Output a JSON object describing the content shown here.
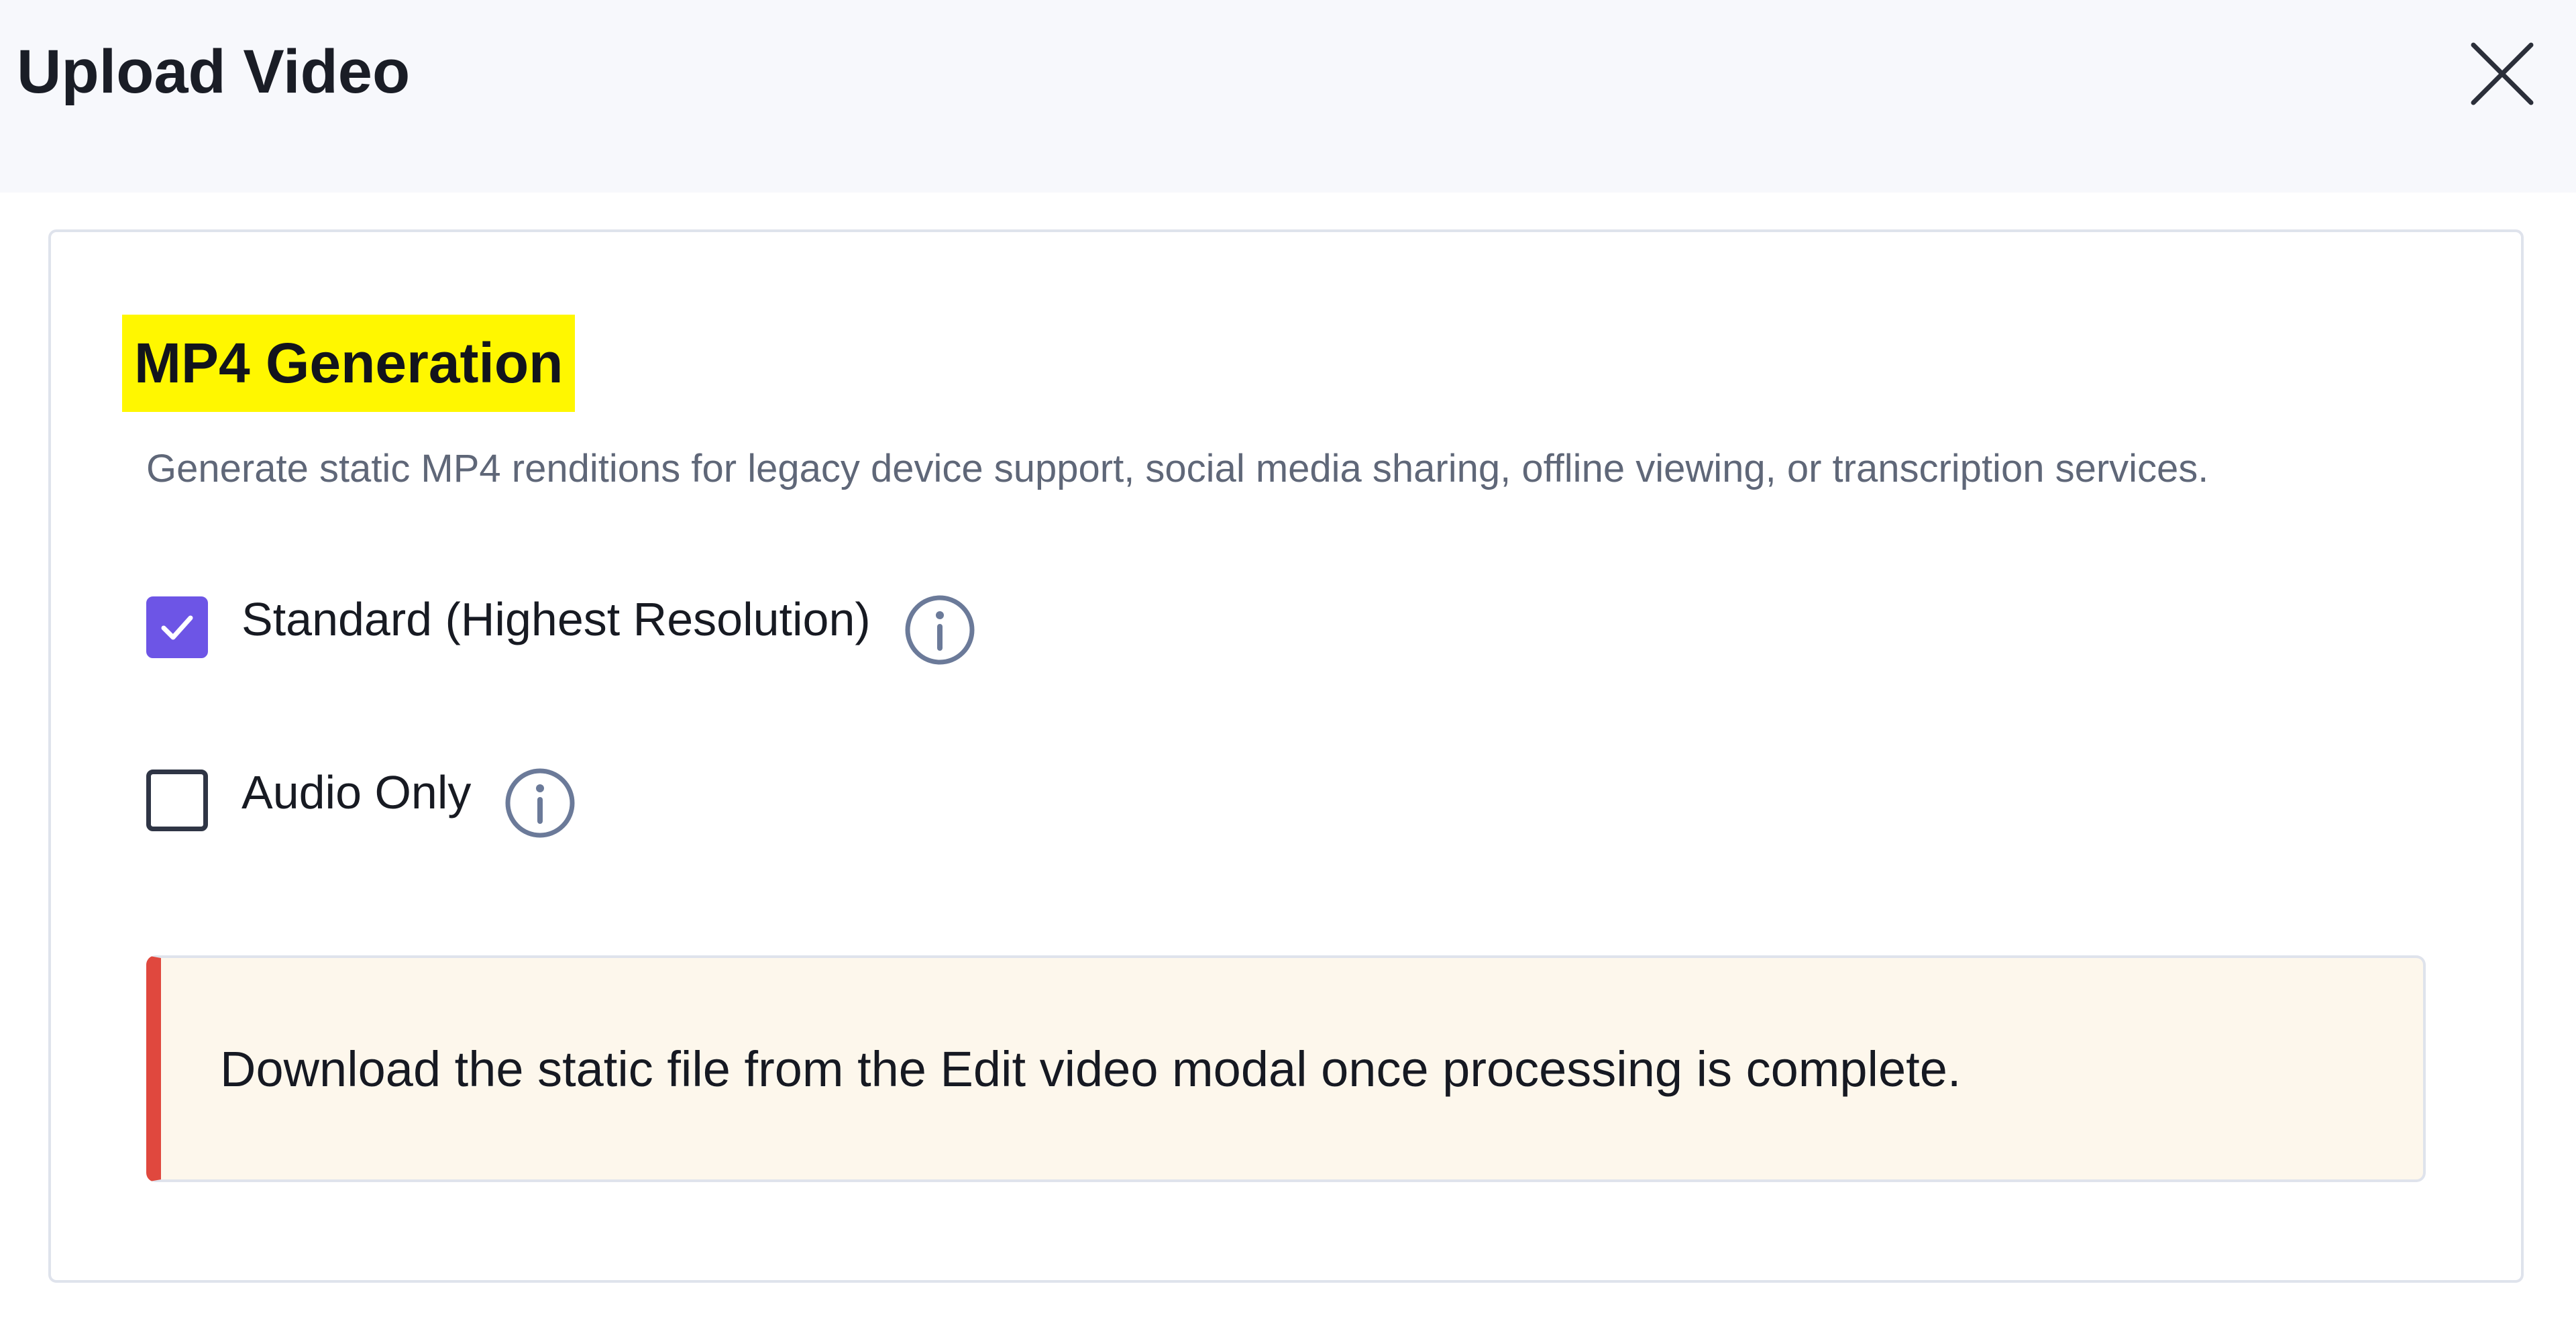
{
  "dialog": {
    "title": "Upload Video",
    "close_icon": "close-icon"
  },
  "mp4_section": {
    "title": "MP4 Generation",
    "description": "Generate static MP4 renditions for legacy device support, social media sharing, offline viewing, or transcription services.",
    "options": [
      {
        "label": "Standard (Highest Resolution)",
        "checked": true,
        "info_icon": "info-icon"
      },
      {
        "label": "Audio Only",
        "checked": false,
        "info_icon": "info-icon"
      }
    ],
    "alert": {
      "text": "Download the static file from the Edit video modal once processing is complete."
    }
  },
  "colors": {
    "header_background": "#f7f8fc",
    "highlight": "#fff700",
    "checkbox_accent": "#6d55e6",
    "alert_background": "#fdf7ec",
    "alert_border_accent": "#e0483e",
    "info_icon": "#6b7a99"
  }
}
